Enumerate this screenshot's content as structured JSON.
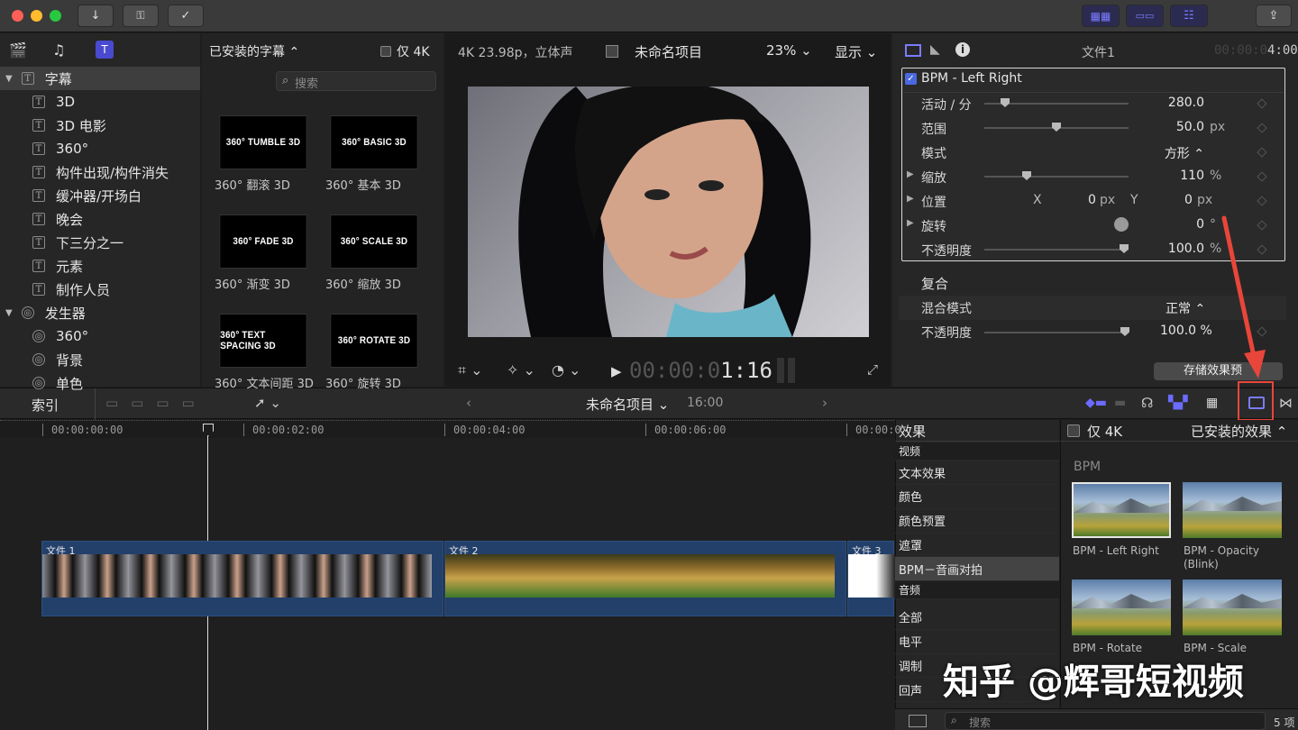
{
  "toolbar": {
    "traffic_lights": [
      "#fe5f57",
      "#febc2e",
      "#28c840"
    ],
    "icons": [
      "download-icon",
      "key-icon",
      "checkmark-icon"
    ],
    "right_icons": [
      "grid-icon",
      "filmstrip-icon",
      "sliders-icon",
      "share-icon"
    ]
  },
  "browser": {
    "tabs_icons": [
      "clapper-icon",
      "music-icon",
      "titles-icon"
    ],
    "dropdown": "已安装的字幕",
    "only_4k": "仅 4K",
    "search_placeholder": "搜索",
    "sidebar": [
      {
        "label": "字幕",
        "type": "group",
        "expanded": true
      },
      {
        "label": "3D",
        "type": "item"
      },
      {
        "label": "3D 电影",
        "type": "item"
      },
      {
        "label": "360°",
        "type": "item"
      },
      {
        "label": "构件出现/构件消失",
        "type": "item"
      },
      {
        "label": "缓冲器/开场白",
        "type": "item"
      },
      {
        "label": "晚会",
        "type": "item"
      },
      {
        "label": "下三分之一",
        "type": "item"
      },
      {
        "label": "元素",
        "type": "item"
      },
      {
        "label": "制作人员",
        "type": "item"
      },
      {
        "label": "发生器",
        "type": "group",
        "expanded": true
      },
      {
        "label": "360°",
        "type": "item2"
      },
      {
        "label": "背景",
        "type": "item2"
      },
      {
        "label": "单色",
        "type": "item2"
      }
    ],
    "thumbs": [
      {
        "title": "360° TUMBLE 3D",
        "label": "360° 翻滚 3D"
      },
      {
        "title": "360° BASIC 3D",
        "label": "360° 基本 3D"
      },
      {
        "title": "360° FADE 3D",
        "label": "360° 渐变 3D"
      },
      {
        "title": "360° SCALE 3D",
        "label": "360° 缩放 3D"
      },
      {
        "title": "360° TEXT SPACING 3D",
        "label": "360° 文本间距 3D"
      },
      {
        "title": "360° ROTATE 3D",
        "label": "360° 旋转 3D"
      }
    ]
  },
  "viewer": {
    "format": "4K 23.98p，立体声",
    "project": "未命名项目",
    "zoom": "23%",
    "display": "显示",
    "timecode_dim": "00:00:0",
    "timecode_bright": "1:16"
  },
  "inspector": {
    "file": "文件1",
    "duration": "00:00:04:00",
    "effect_name": "BPM - Left Right",
    "rows": [
      {
        "label": "活动 / 分",
        "value": "280.0",
        "unit": "",
        "slider": 0.12
      },
      {
        "label": "范围",
        "value": "50.0",
        "unit": "px",
        "slider": 0.5
      },
      {
        "label": "模式",
        "value": "方形 ⌃",
        "unit": ""
      },
      {
        "label": "缩放",
        "value": "110",
        "unit": "%",
        "slider": 0.28,
        "disclosure": true
      },
      {
        "label": "位置",
        "x_label": "X",
        "x_val": "0",
        "x_unit": "px",
        "y_label": "Y",
        "y_val": "0",
        "y_unit": "px",
        "disclosure": true
      },
      {
        "label": "旋转",
        "value": "0",
        "unit": "°",
        "disclosure": true
      },
      {
        "label": "不透明度",
        "value": "100.0",
        "unit": "%",
        "slider": 1.0
      }
    ],
    "composite_title": "复合",
    "blend_label": "混合模式",
    "blend_value": "正常",
    "opacity_label": "不透明度",
    "opacity_value": "100.0",
    "opacity_unit": "%",
    "save_preset": "存储效果预"
  },
  "timeline_bar": {
    "index": "索引",
    "project": "未命名项目",
    "duration": "16:00"
  },
  "timeline": {
    "ruler": [
      "00:00:00:00",
      "00:00:02:00",
      "00:00:04:00",
      "00:00:06:00",
      "00:00:0"
    ],
    "clips": [
      "文件 1",
      "文件 2",
      "文件 3"
    ]
  },
  "effects": {
    "header": "效果",
    "only_4k": "仅 4K",
    "installed": "已安装的效果",
    "categories": [
      {
        "label": "视频",
        "type": "header"
      },
      {
        "label": "文本效果"
      },
      {
        "label": "颜色"
      },
      {
        "label": "颜色预置"
      },
      {
        "label": "遮罩"
      },
      {
        "label": "BPM－音画对拍",
        "selected": true
      },
      {
        "label": "音频",
        "type": "header"
      },
      {
        "label": "全部"
      },
      {
        "label": "电平"
      },
      {
        "label": "调制"
      },
      {
        "label": "回声"
      }
    ],
    "group": "BPM",
    "items": [
      "BPM - Left Right",
      "BPM - Opacity (Blink)",
      "BPM - Rotate",
      "BPM - Scale"
    ],
    "search_placeholder": "搜索",
    "count": "5 项"
  },
  "watermark": "知乎 @辉哥短视频",
  "colors": {
    "accent": "#7b7bff",
    "highlight": "#e8463a",
    "clip": "#23406b"
  }
}
